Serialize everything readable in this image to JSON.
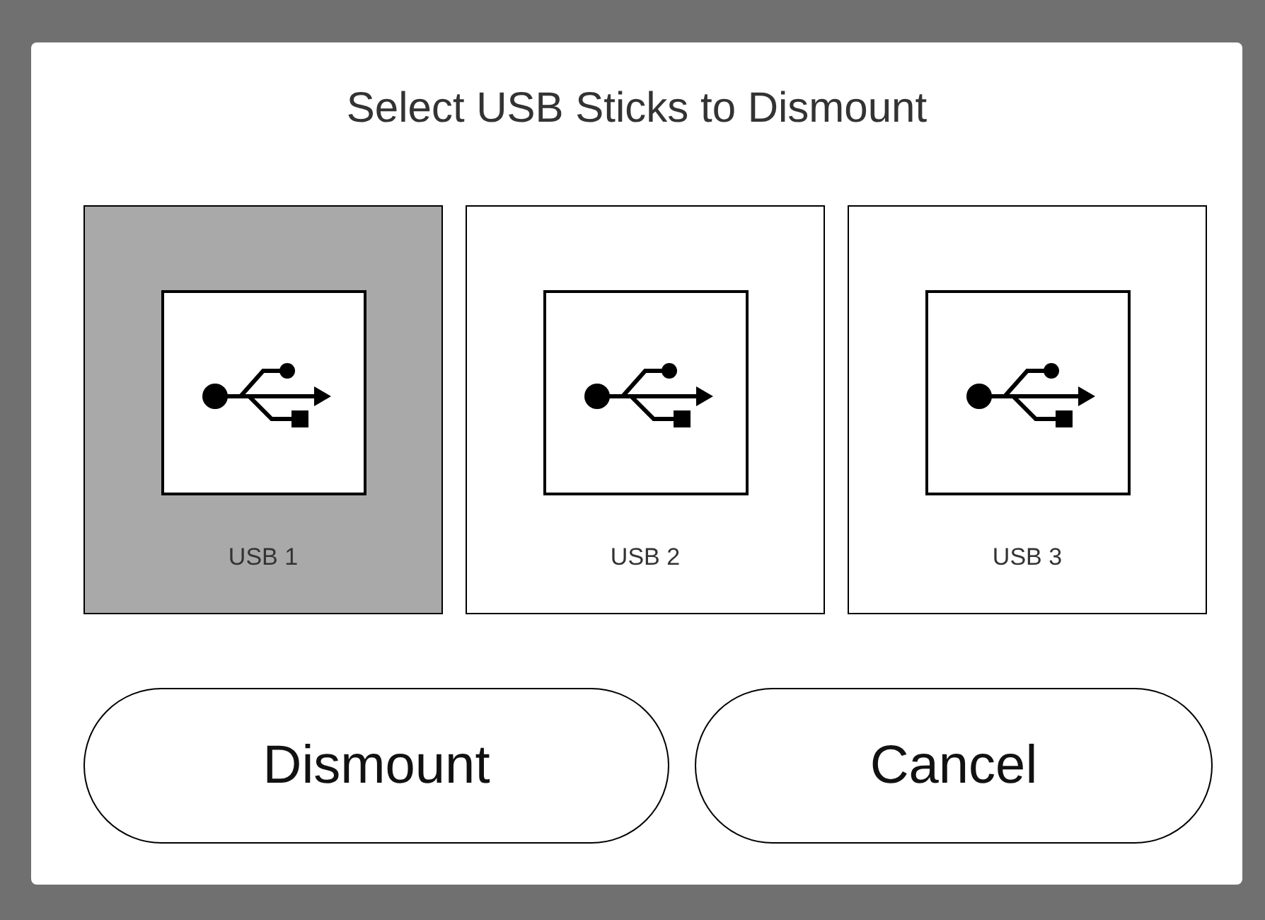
{
  "dialog": {
    "title": "Select USB Sticks to Dismount"
  },
  "sticks": [
    {
      "label": "USB 1",
      "selected": true
    },
    {
      "label": "USB 2",
      "selected": false
    },
    {
      "label": "USB 3",
      "selected": false
    }
  ],
  "buttons": [
    "Dismount",
    "Cancel"
  ]
}
